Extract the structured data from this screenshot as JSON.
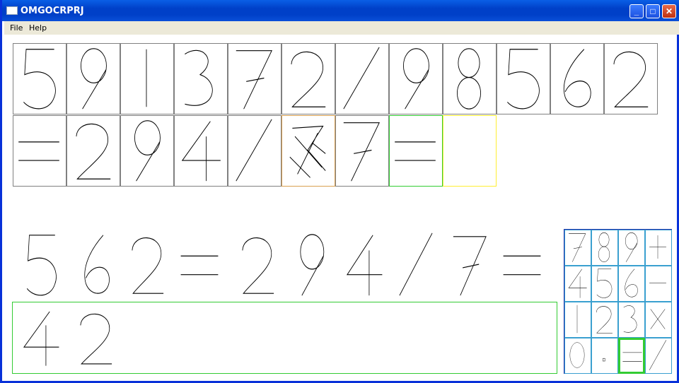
{
  "window": {
    "title": "OMGOCRPRJ"
  },
  "menu": {
    "items": [
      "File",
      "Help"
    ]
  },
  "samples": {
    "row1": [
      "5",
      "9",
      "1",
      "3",
      "7",
      "2",
      "/",
      "9",
      "8",
      "5",
      "6",
      "2"
    ],
    "row2": [
      "=",
      "2",
      "9",
      "4",
      "/",
      "scribble",
      "7",
      "=",
      ""
    ],
    "row2_states": [
      "normal",
      "normal",
      "normal",
      "normal",
      "normal",
      "rejected",
      "normal",
      "accepted",
      "empty"
    ]
  },
  "expression": {
    "tokens": [
      "5",
      "6",
      "2",
      "=",
      "2",
      "9",
      "4",
      "/",
      "7",
      "="
    ]
  },
  "result": {
    "tokens": [
      "4",
      "2"
    ]
  },
  "keypad": {
    "keys": [
      [
        "7",
        "8",
        "9",
        "+"
      ],
      [
        "4",
        "5",
        "6",
        "-"
      ],
      [
        "1",
        "2",
        "3",
        "x"
      ],
      [
        "0",
        ".",
        "=",
        "/"
      ]
    ],
    "selected": "="
  },
  "colors": {
    "accepted": "#33cc33",
    "rejected": "#d9a050",
    "empty": "#ffee33",
    "keypad_border": "#2233aa",
    "key_border": "#3aa0d0"
  }
}
